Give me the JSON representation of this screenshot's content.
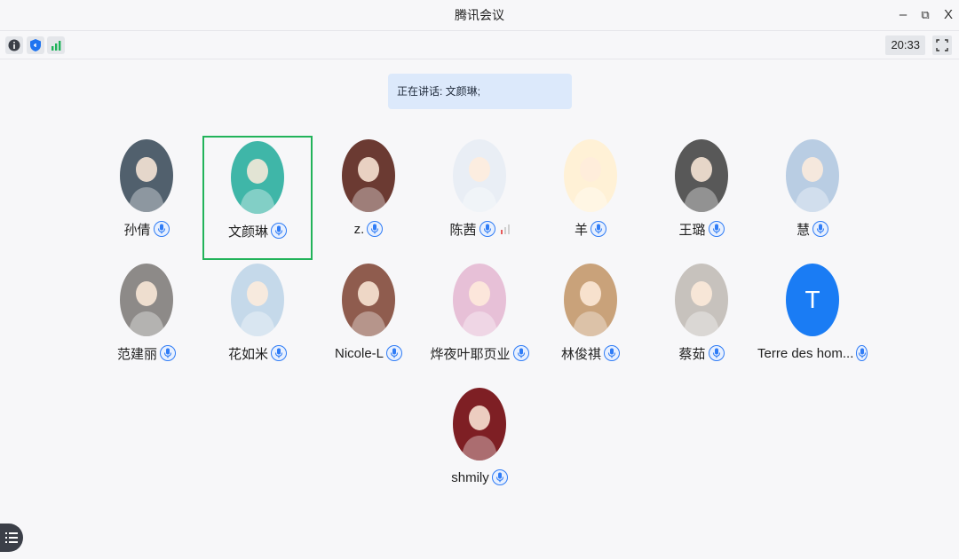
{
  "window": {
    "title": "腾讯会议",
    "controls": {
      "minimize": "–",
      "restore": "⧉",
      "close": "X"
    }
  },
  "toolbar": {
    "info_icon": "info-icon",
    "security_icon": "shield-icon",
    "network_icon": "signal-bars-icon",
    "clock": "20:33",
    "fullscreen_icon": "fullscreen-icon"
  },
  "speaking": {
    "label": "正在讲话: 文颜琳;"
  },
  "participants": [
    {
      "name": "孙倩",
      "avatar_color": "#51606d",
      "avatar_kind": "cartoon-boy"
    },
    {
      "name": "文颜琳",
      "avatar_color": "#3fb6a8",
      "avatar_kind": "lion-cartoon",
      "active": true,
      "mic_active": true
    },
    {
      "name": "z.",
      "avatar_color": "#6b3a32",
      "avatar_kind": "photo-person"
    },
    {
      "name": "陈茜",
      "avatar_color": "#e9eef5",
      "avatar_kind": "anime-girl",
      "volume_bars": true
    },
    {
      "name": "羊",
      "avatar_color": "#fff1d6",
      "avatar_kind": "cartoon-girl"
    },
    {
      "name": "王璐",
      "avatar_color": "#585858",
      "avatar_kind": "photo-person"
    },
    {
      "name": "慧",
      "avatar_color": "#b9cde3",
      "avatar_kind": "photo-person"
    },
    {
      "name": "范建丽",
      "avatar_color": "#8d8a88",
      "avatar_kind": "photo-person"
    },
    {
      "name": "花如米",
      "avatar_color": "#c5d9ea",
      "avatar_kind": "photo-person"
    },
    {
      "name": "Nicole-L",
      "avatar_color": "#8f5c4e",
      "avatar_kind": "photo-person"
    },
    {
      "name": "烨夜叶耶页业",
      "avatar_color": "#e7c0d7",
      "avatar_kind": "cartoon-boy"
    },
    {
      "name": "林俊祺",
      "avatar_color": "#c9a27a",
      "avatar_kind": "cat-photo"
    },
    {
      "name": "蔡茹",
      "avatar_color": "#c7c2bd",
      "avatar_kind": "photo-person"
    },
    {
      "name": "Terre des hom...",
      "avatar_color": "#1a7cf4",
      "avatar_letter": "T",
      "avatar_kind": "letter"
    },
    {
      "name": "shmily",
      "avatar_color": "#7e1f24",
      "avatar_kind": "photo-person"
    }
  ],
  "bottom": {
    "menu_icon": "list-menu-icon"
  }
}
